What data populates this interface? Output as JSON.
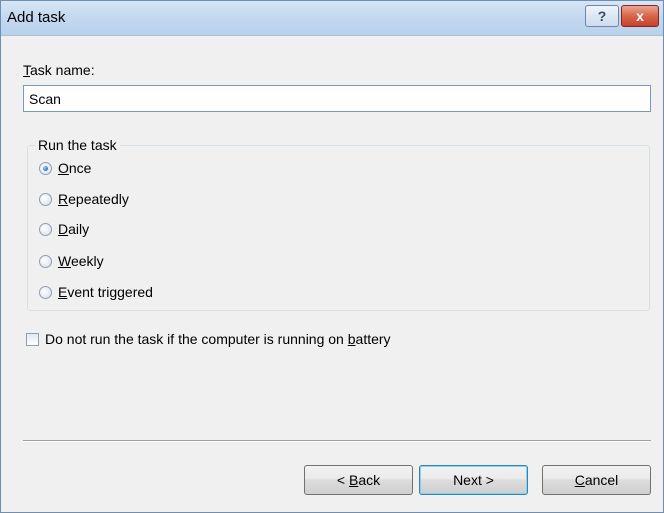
{
  "window": {
    "title": "Add task",
    "help_glyph": "?",
    "close_glyph": "x"
  },
  "task_name": {
    "label_mnemonic": "T",
    "label_rest": "ask name:",
    "value": "Scan"
  },
  "run_group": {
    "legend": "Run the task",
    "selected": "Once",
    "options": [
      {
        "mnemonic": "O",
        "rest": "nce",
        "checked": true
      },
      {
        "mnemonic": "R",
        "rest": "epeatedly",
        "checked": false
      },
      {
        "mnemonic": "D",
        "rest": "aily",
        "checked": false
      },
      {
        "mnemonic": "W",
        "rest": "eekly",
        "checked": false
      },
      {
        "mnemonic": "E",
        "rest": "vent triggered",
        "checked": false
      }
    ]
  },
  "battery_option": {
    "label_before": "Do not run the task if the computer is running on ",
    "label_mnemonic": "b",
    "label_after": "attery",
    "checked": false
  },
  "buttons": {
    "back_prefix": "< ",
    "back_mnemonic": "B",
    "back_rest": "ack",
    "next_label": "Next >",
    "cancel_mnemonic": "C",
    "cancel_rest": "ancel"
  },
  "colors": {
    "accent": "#2a6fc4",
    "titlebar": "#c4d9f0",
    "close": "#c8402a"
  }
}
